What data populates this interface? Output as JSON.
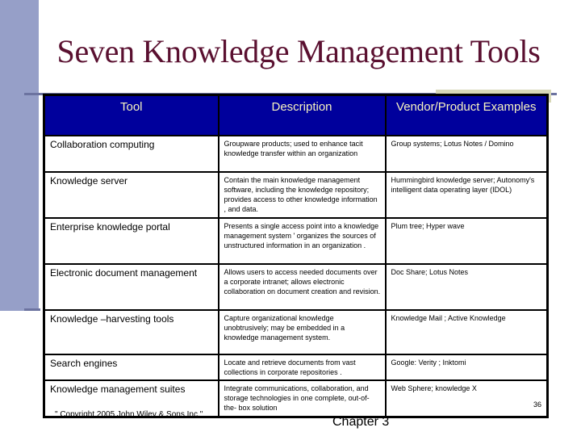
{
  "slide": {
    "title": "Seven Knowledge Management Tools",
    "page_number": "36",
    "copyright": "\" Copyright 2005 John Wiley & Sons Inc.\"",
    "chapter": "Chapter 3"
  },
  "table": {
    "headers": [
      "Tool",
      "Description",
      "Vendor/Product Examples"
    ],
    "rows": [
      {
        "tool": "Collaboration computing",
        "description": "Groupware products; used to enhance tacit knowledge transfer within an organization",
        "vendors": "Group systems; Lotus Notes / Domino"
      },
      {
        "tool": "Knowledge server",
        "description": "Contain the main knowledge management software, including the knowledge repository; provides access to other knowledge information , and data.",
        "vendors": "Hummingbird knowledge server; Autonomy's intelligent data operating layer (IDOL)"
      },
      {
        "tool": "Enterprise knowledge portal",
        "description": "Presents a single access point into a knowledge management system ' organizes the sources of unstructured information in an organization .",
        "vendors": "Plum tree; Hyper wave"
      },
      {
        "tool": "Electronic document management",
        "description": "Allows users to access needed documents over a corporate intranet; allows electronic collaboration on document creation and revision.",
        "vendors": "Doc Share; Lotus Notes"
      },
      {
        "tool": "Knowledge –harvesting tools",
        "description": "Capture organizational knowledge unobtrusively; may be embedded in a knowledge management system.",
        "vendors": "Knowledge Mail ; Active Knowledge"
      },
      {
        "tool": "Search engines",
        "description": "Locate and retrieve documents from vast collections in corporate repositories .",
        "vendors": "Google: Verity ; Inktomi"
      },
      {
        "tool": "Knowledge management suites",
        "description": "Integrate communications, collaboration, and storage technologies  in one complete, out-of- the- box solution",
        "vendors": "Web Sphere; knowledge X"
      }
    ]
  },
  "colors": {
    "title": "#5a1030",
    "header_bg": "#00009c",
    "header_text": "#f8f4c0",
    "left_bar": "#969fc8"
  }
}
